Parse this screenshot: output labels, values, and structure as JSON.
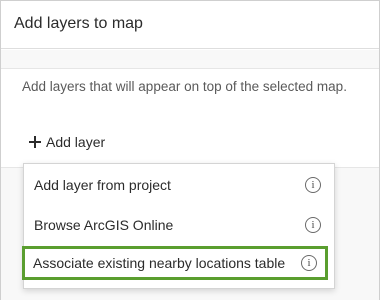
{
  "panel": {
    "title": "Add layers to map",
    "description": "Add layers that will appear on top of the selected map."
  },
  "add_layer": {
    "label": "Add layer",
    "icon": "plus-icon"
  },
  "menu": {
    "items": [
      {
        "label": "Add layer from project",
        "icon": "info-icon"
      },
      {
        "label": "Browse ArcGIS Online",
        "icon": "info-icon"
      },
      {
        "label": "Associate existing nearby locations table",
        "icon": "info-icon",
        "highlighted": true
      }
    ]
  },
  "colors": {
    "highlight_border": "#5a9e2f",
    "text": "#2b2b2b",
    "muted_text": "#5a5a5a"
  }
}
